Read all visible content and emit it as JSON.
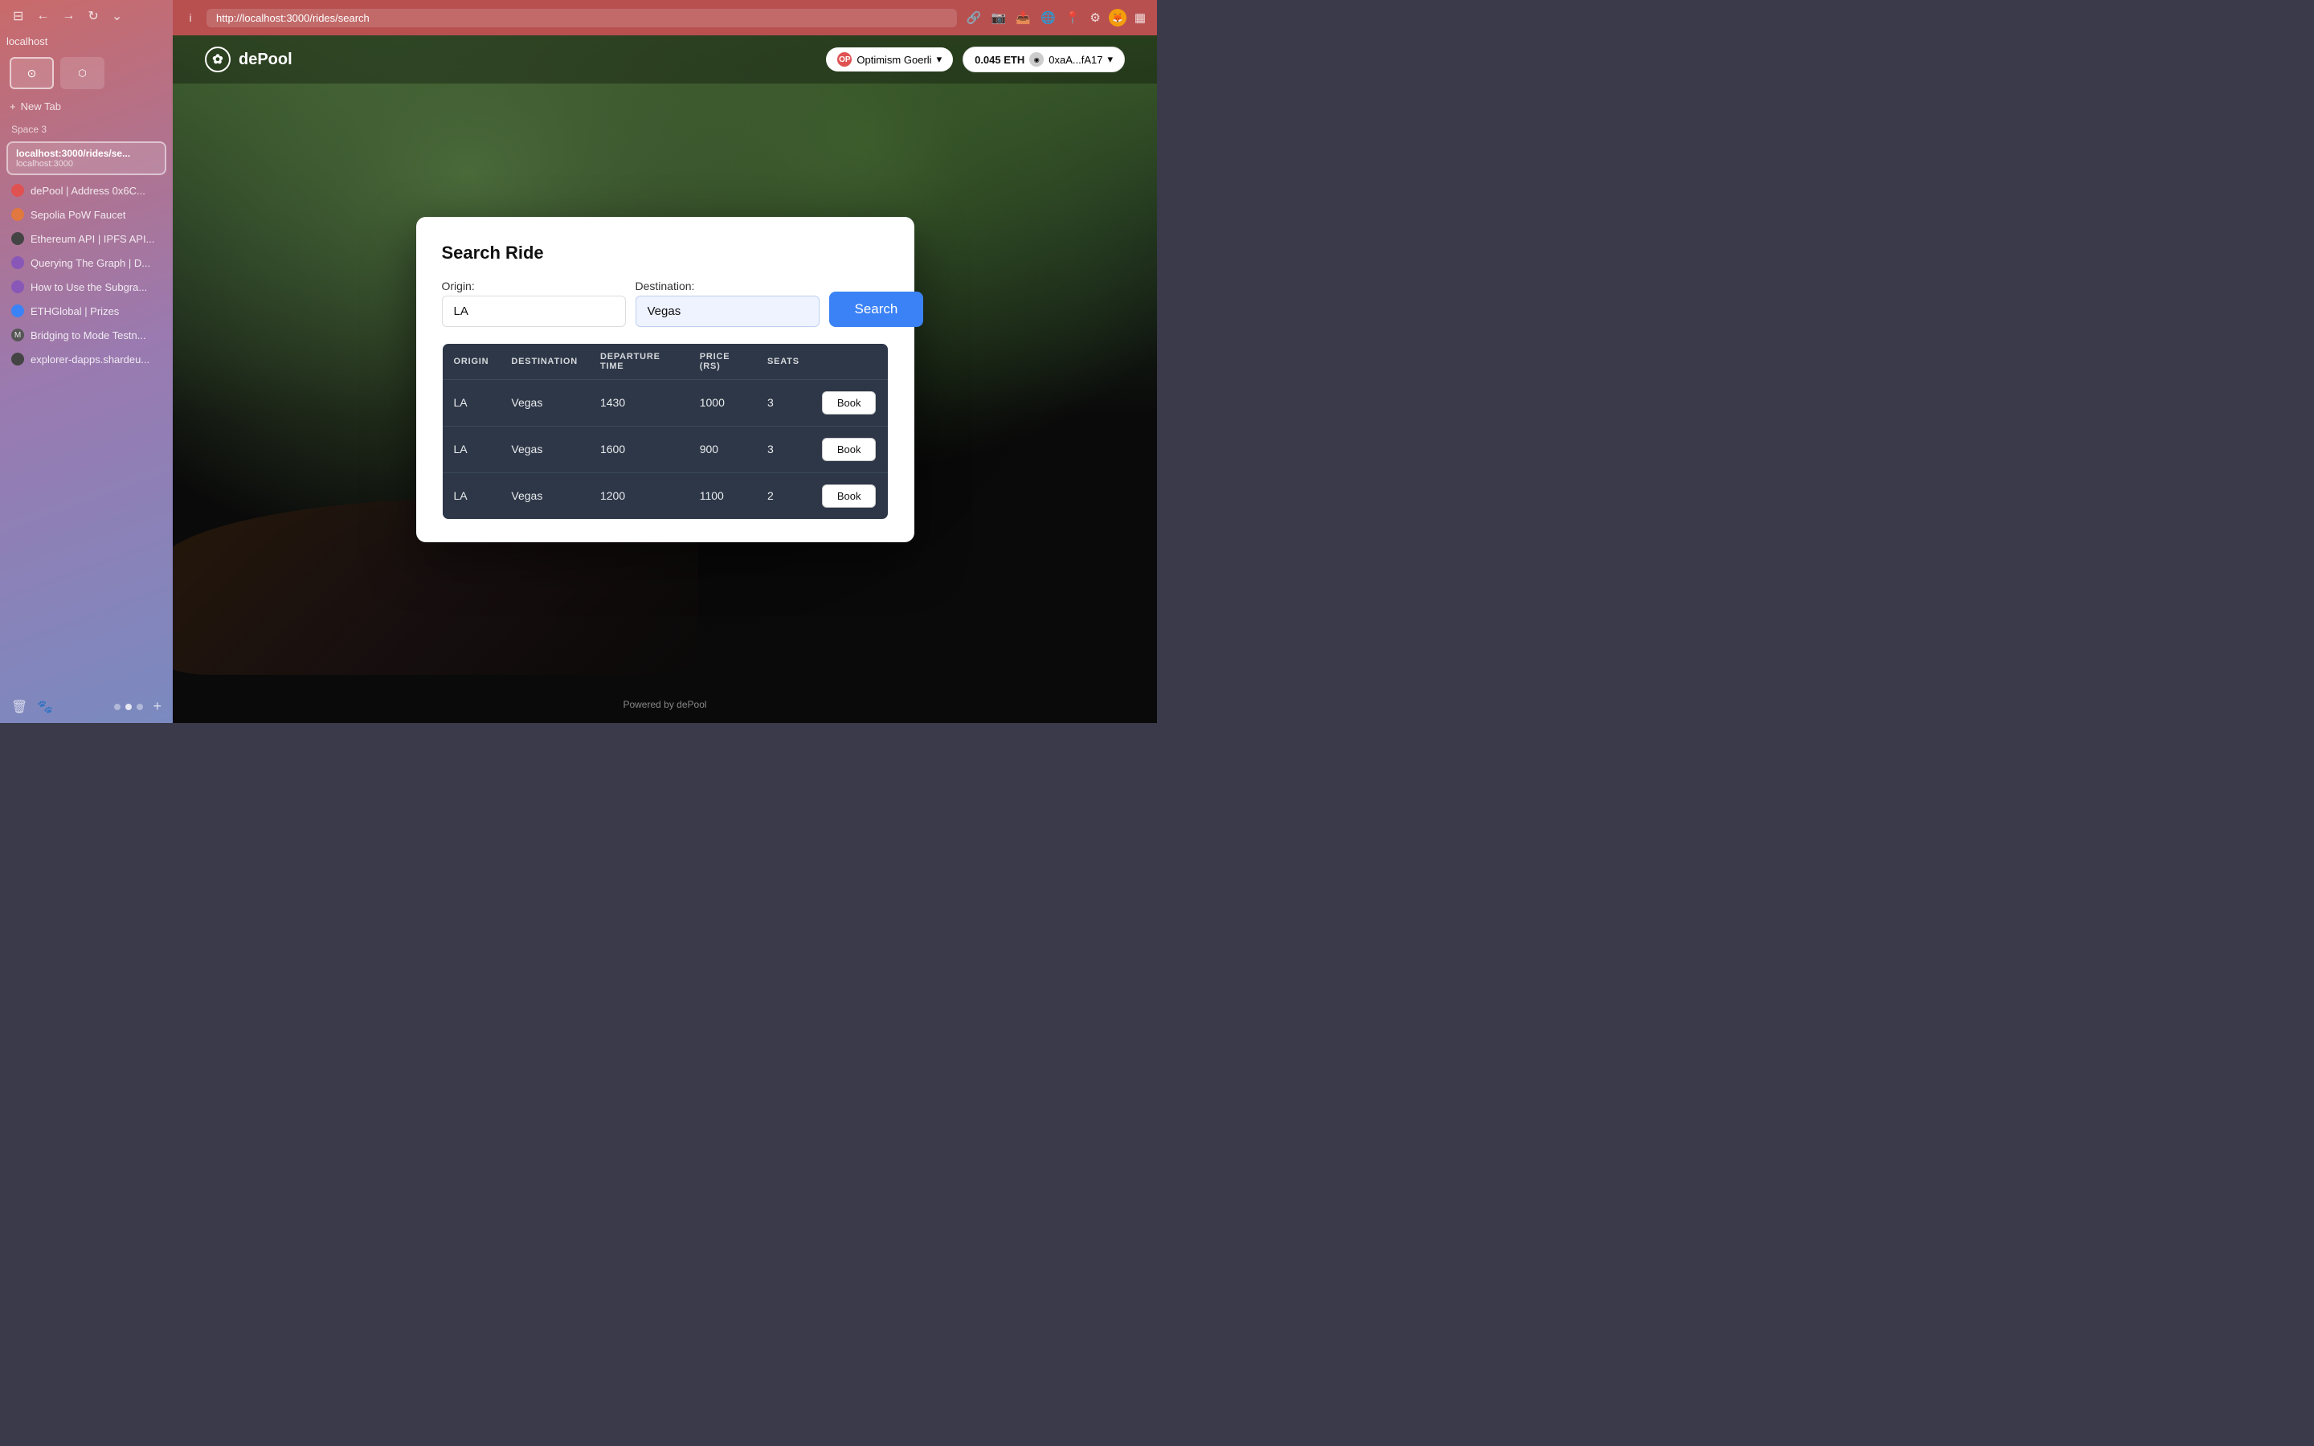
{
  "sidebar": {
    "localhost_label": "localhost",
    "space_label": "Space 3",
    "new_tab_label": "New Tab",
    "current_tab": {
      "title": "localhost:3000/rides/se...",
      "url": "localhost:3000"
    },
    "bookmarks": [
      {
        "id": "depool-address",
        "label": "dePool | Address 0x6C...",
        "favicon_type": "red",
        "favicon_char": "●"
      },
      {
        "id": "sepolia-faucet",
        "label": "Sepolia PoW Faucet",
        "favicon_type": "orange",
        "favicon_char": "●"
      },
      {
        "id": "ethereum-api",
        "label": "Ethereum API | IPFS API...",
        "favicon_type": "dark",
        "favicon_char": "⬡"
      },
      {
        "id": "the-graph",
        "label": "Querying The Graph | D...",
        "favicon_type": "purple",
        "favicon_char": "●"
      },
      {
        "id": "subgraph",
        "label": "How to Use the Subgra...",
        "favicon_type": "purple",
        "favicon_char": "●"
      },
      {
        "id": "ethglobal",
        "label": "ETHGlobal | Prizes",
        "favicon_type": "blue",
        "favicon_char": "●"
      },
      {
        "id": "mode-bridge",
        "label": "Bridging to Mode Testn...",
        "favicon_type": "m",
        "favicon_char": "M"
      },
      {
        "id": "explorer",
        "label": "explorer-dapps.shardeu...",
        "favicon_type": "dark",
        "favicon_char": "●"
      }
    ]
  },
  "browser": {
    "url": "http://localhost:3000/rides/search",
    "info_icon": "i"
  },
  "app": {
    "logo": "dePool",
    "network_btn": "Optimism Goerli",
    "eth_amount": "0.045 ETH",
    "wallet_address": "0xaA...fA17",
    "powered_by": "Powered by dePool"
  },
  "modal": {
    "title": "Search Ride",
    "origin_label": "Origin:",
    "origin_value": "LA",
    "destination_label": "Destination:",
    "destination_value": "Vegas",
    "search_btn_label": "Search",
    "table_headers": [
      "ORIGIN",
      "DESTINATION",
      "DEPARTURE TIME",
      "PRICE (RS)",
      "SEATS",
      ""
    ],
    "rides": [
      {
        "origin": "LA",
        "destination": "Vegas",
        "departure": "1430",
        "price": "1000",
        "seats": "3"
      },
      {
        "origin": "LA",
        "destination": "Vegas",
        "departure": "1600",
        "price": "900",
        "seats": "3"
      },
      {
        "origin": "LA",
        "destination": "Vegas",
        "departure": "1200",
        "price": "1100",
        "seats": "2"
      }
    ],
    "book_btn_label": "Book"
  }
}
